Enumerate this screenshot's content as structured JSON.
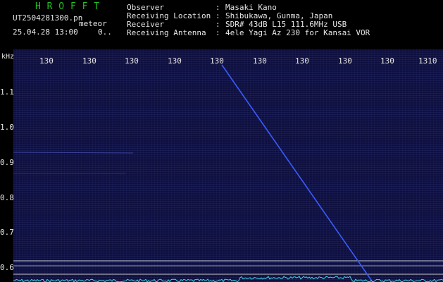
{
  "app_title": "H R O F F T",
  "file_name": "UT2504281300.pn",
  "file_tag": "meteor",
  "datetime": "25.04.28 13:00",
  "counter": "0..",
  "info": [
    {
      "label": "Observer",
      "sep": ":",
      "value": "Masaki Kano"
    },
    {
      "label": "Receiving Location",
      "sep": ":",
      "value": "Shibukawa, Gunma, Japan"
    },
    {
      "label": "Receiver",
      "sep": ":",
      "value": "SDR# 43dB L15 111.6MHz USB"
    },
    {
      "label": "Receiving Antenna",
      "sep": ":",
      "value": "4ele Yagi Az 230 for Kansai VOR"
    }
  ],
  "y_unit": "kHz",
  "y_ticks": [
    "1.1",
    "1.0",
    "0.9",
    "0.8",
    "0.7",
    "0.6"
  ],
  "x_ticks": [
    "130",
    "130",
    "130",
    "130",
    "130",
    "130",
    "130",
    "130",
    "130",
    "1310"
  ],
  "colors": {
    "background": "#000000",
    "plot_bg": "#0e0f3e",
    "title": "#22c022",
    "text": "#e6e6e6",
    "trace": "#3a5cff",
    "spectrum": "#3fd8e8",
    "gridline": "#c8c8c8"
  }
}
